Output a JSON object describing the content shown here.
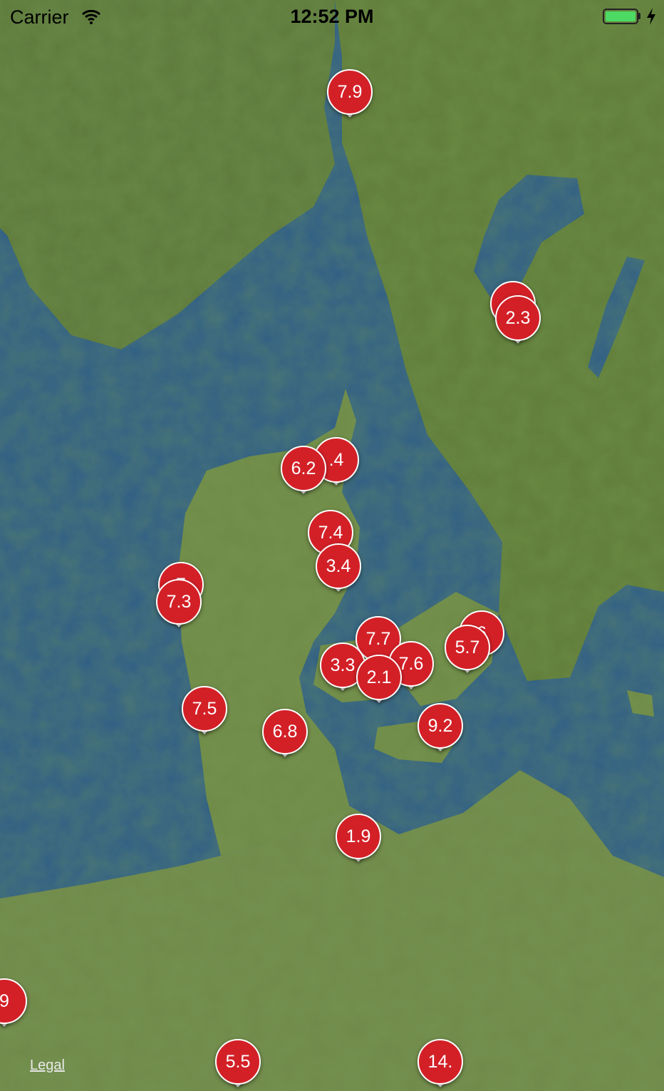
{
  "status_bar": {
    "carrier": "Carrier",
    "time": "12:52 PM",
    "battery_color": "#4cd964",
    "wifi_icon": "wifi-icon",
    "charging_icon": "bolt-icon"
  },
  "map": {
    "legal_label": "Legal",
    "marker_color": "#d32027",
    "markers": [
      {
        "value": "7.9"
      },
      {
        "value": ""
      },
      {
        "value": "2.3"
      },
      {
        "value": ".4"
      },
      {
        "value": "6.2"
      },
      {
        "value": "7.4"
      },
      {
        "value": "3.4"
      },
      {
        "value": "7"
      },
      {
        "value": "7.3"
      },
      {
        "value": "7.7"
      },
      {
        "value": "6"
      },
      {
        "value": "5.7"
      },
      {
        "value": "7.6"
      },
      {
        "value": "3.3"
      },
      {
        "value": "2.1"
      },
      {
        "value": "7.5"
      },
      {
        "value": "6.8"
      },
      {
        "value": "9.2"
      },
      {
        "value": "1.9"
      },
      {
        "value": "9"
      },
      {
        "value": "5.5"
      },
      {
        "value": "14."
      }
    ]
  }
}
